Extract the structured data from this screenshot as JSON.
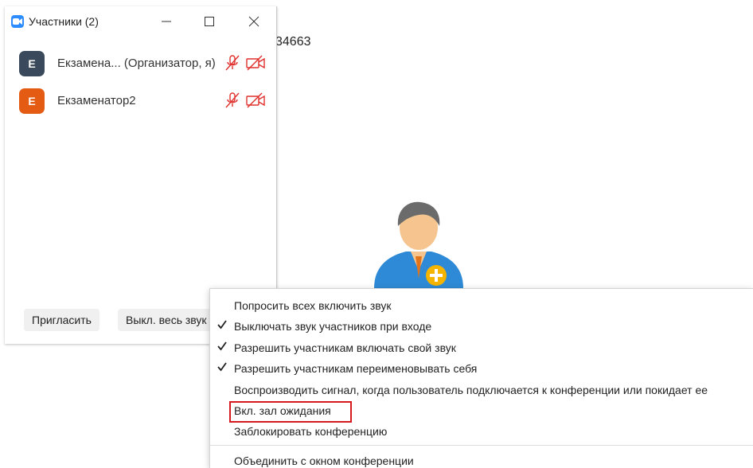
{
  "meeting": {
    "id_fragment": "34663"
  },
  "window": {
    "title": "Участники (2)"
  },
  "participants": [
    {
      "initial": "E",
      "name": "Екзамена... (Организатор, я)",
      "avatar_color": "#3a4a5c",
      "mic": "muted",
      "video": "off"
    },
    {
      "initial": "E",
      "name": "Екзаменатор2",
      "avatar_color": "#e45b13",
      "mic": "muted",
      "video": "off"
    }
  ],
  "buttons": {
    "invite": "Пригласить",
    "mute_all": "Выкл. весь звук"
  },
  "menu": {
    "items": [
      {
        "label": "Попросить всех включить звук",
        "checked": false
      },
      {
        "label": "Выключать звук участников при входе",
        "checked": true
      },
      {
        "label": "Разрешить участникам включать свой звук",
        "checked": true
      },
      {
        "label": "Разрешить участникам переименовывать себя",
        "checked": true
      },
      {
        "label": "Воспроизводить сигнал, когда пользователь подключается к конференции или покидает ее",
        "checked": false
      },
      {
        "label": "Вкл. зал ожидания",
        "checked": false,
        "highlighted": true
      },
      {
        "label": "Заблокировать конференцию",
        "checked": false
      },
      {
        "label": "Объединить с окном конференции",
        "checked": false
      }
    ]
  },
  "colors": {
    "accent": "#2d8cff",
    "muted_red": "#e0302c",
    "highlight_border": "#d6181f"
  }
}
